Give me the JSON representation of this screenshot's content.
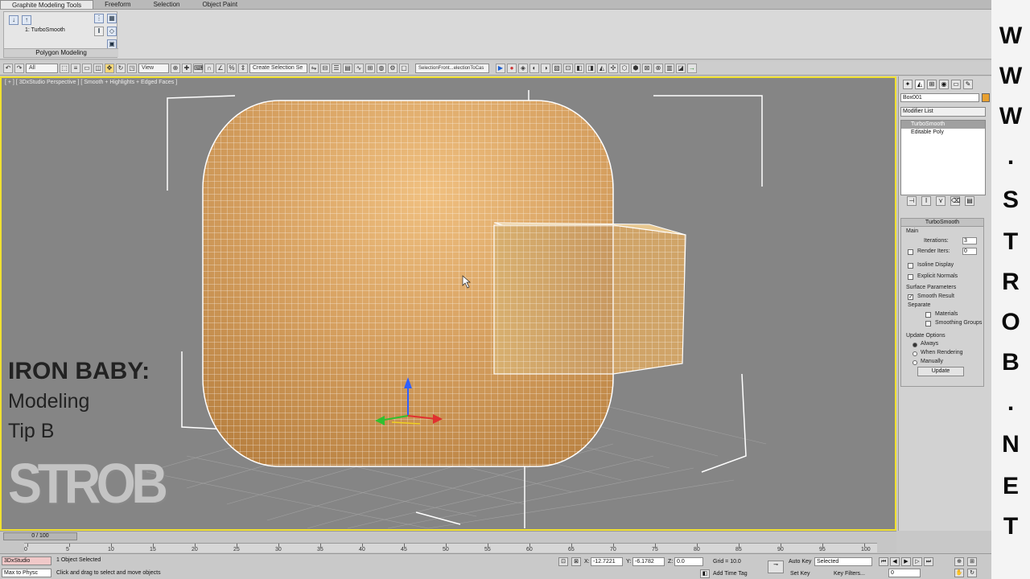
{
  "ribbon": {
    "tabs": [
      "Graphite Modeling Tools",
      "Freeform",
      "Selection",
      "Object Paint"
    ],
    "panel_item": "1: TurboSmooth",
    "panel_label": "Polygon Modeling"
  },
  "toolbar": {
    "filter": "All",
    "ref_coord": "View",
    "named_sel": "Create Selection Se",
    "snap_label": "SelectionFront...electionToCas"
  },
  "viewport": {
    "label": "[ + ] [ 3DxStudio Perspective ] [ Smooth + Highlights + Edged Faces ]",
    "overlay_title": "IRON BABY:",
    "overlay_sub1": "Modeling",
    "overlay_sub2": "Tip B",
    "logo": "STROB"
  },
  "command_panel": {
    "object_name": "Box001",
    "modifier_list": "Modifier List",
    "stack": [
      "TurboSmooth",
      "Editable Poly"
    ],
    "rollout_title": "TurboSmooth",
    "main_label": "Main",
    "iterations_label": "Iterations:",
    "iterations_value": "3",
    "render_iters_label": "Render Iters:",
    "render_iters_value": "0",
    "isoline": "Isoline Display",
    "explicit_normals": "Explicit Normals",
    "surface_params": "Surface Parameters",
    "smooth_result": "Smooth Result",
    "separate": "Separate",
    "materials": "Materials",
    "smoothing_groups": "Smoothing Groups",
    "update_options": "Update Options",
    "always": "Always",
    "when_rendering": "When Rendering",
    "manually": "Manually",
    "update_button": "Update"
  },
  "banner": {
    "letters": [
      "W",
      "W",
      "W",
      ".",
      "S",
      "T",
      "R",
      "O",
      "B",
      ".",
      "N",
      "E",
      "T"
    ]
  },
  "timeline": {
    "slider": "0 / 100",
    "ticks": [
      "0",
      "5",
      "10",
      "15",
      "20",
      "25",
      "30",
      "35",
      "40",
      "45",
      "50",
      "55",
      "60",
      "65",
      "70",
      "75",
      "80",
      "85",
      "90",
      "95",
      "100"
    ]
  },
  "status": {
    "maxscript_top": "Max to Physc",
    "maxscript_bottom": "3DxStudio",
    "selected": "1 Object Selected",
    "prompt": "Click and drag to select and move objects",
    "x_label": "X:",
    "x_value": "-12.7221",
    "y_label": "Y:",
    "y_value": "-6.1782",
    "z_label": "Z:",
    "z_value": "0.0",
    "grid_label": "Grid = 10.0",
    "add_time_tag": "Add Time Tag",
    "auto_key": "Auto Key",
    "set_key": "Set Key",
    "selected_dd": "Selected",
    "key_filters": "Key Filters...",
    "frame": "0"
  }
}
